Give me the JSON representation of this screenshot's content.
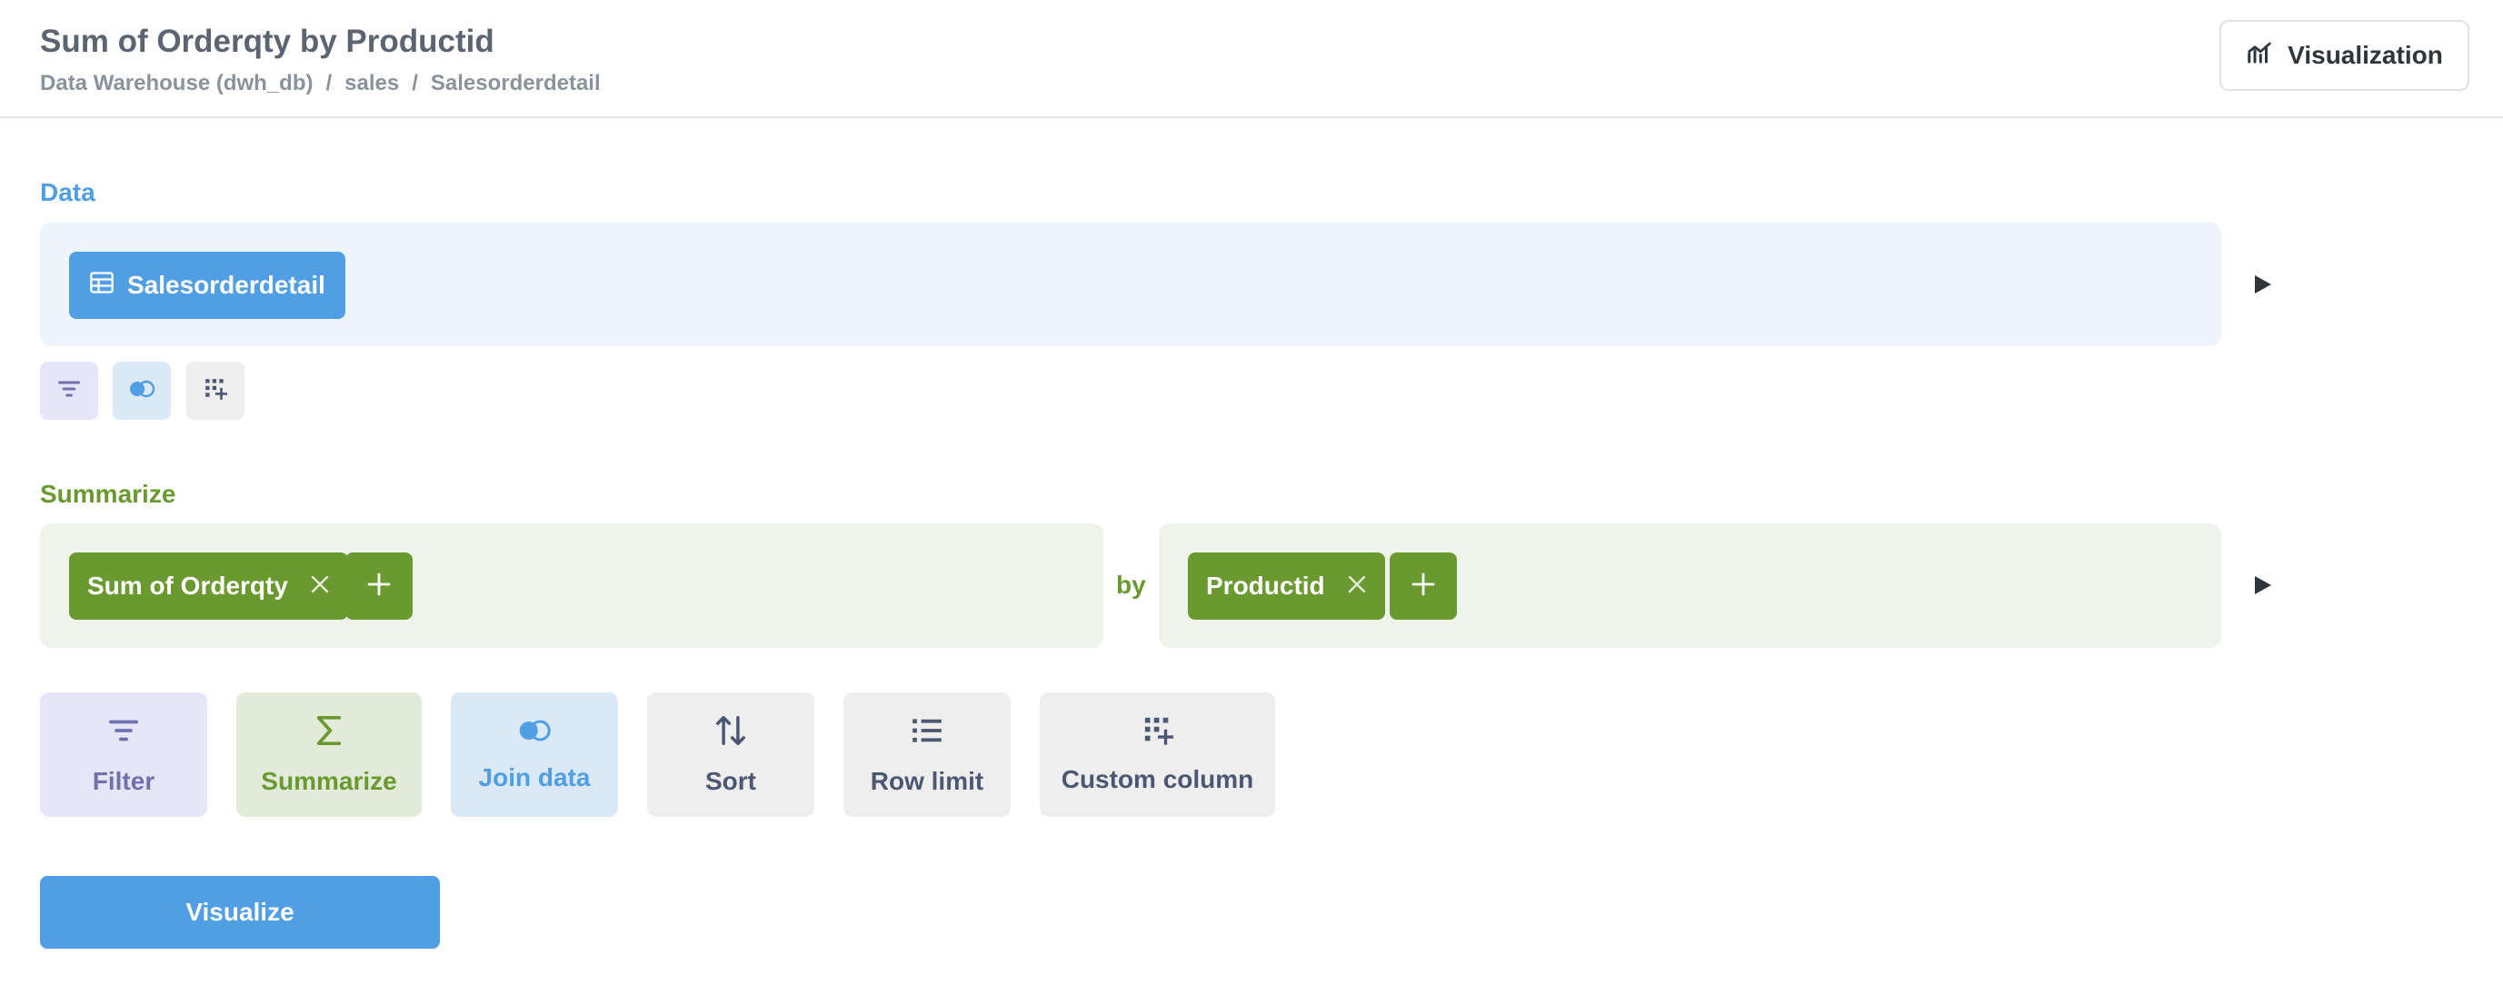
{
  "header": {
    "title": "Sum of Orderqty by Productid",
    "breadcrumb": [
      "Data Warehouse (dwh_db)",
      "sales",
      "Salesorderdetail"
    ],
    "breadcrumb_separator": "/",
    "visualization_toggle_label": "Visualization",
    "visualization_icon": "line-chart-icon"
  },
  "data_step": {
    "label": "Data",
    "table_name": "Salesorderdetail",
    "table_icon": "table-icon",
    "mini_actions": [
      {
        "name": "filter",
        "icon": "filter-icon"
      },
      {
        "name": "join",
        "icon": "join-icon"
      },
      {
        "name": "custom-column",
        "icon": "custom-column-icon"
      }
    ]
  },
  "summarize_step": {
    "label": "Summarize",
    "metric": "Sum of Orderqty",
    "by_label": "by",
    "breakout": "Productid"
  },
  "actions": [
    {
      "label": "Filter",
      "icon": "filter-icon"
    },
    {
      "label": "Summarize",
      "icon": "sigma-icon"
    },
    {
      "label": "Join data",
      "icon": "join-icon"
    },
    {
      "label": "Sort",
      "icon": "sort-icon"
    },
    {
      "label": "Row limit",
      "icon": "list-icon"
    },
    {
      "label": "Custom column",
      "icon": "custom-column-icon"
    }
  ],
  "visualize_button_label": "Visualize",
  "colors": {
    "brand": "#509ee3",
    "summarize": "#6a9a2f",
    "filter": "#7172ad",
    "title": "#5b6470"
  }
}
